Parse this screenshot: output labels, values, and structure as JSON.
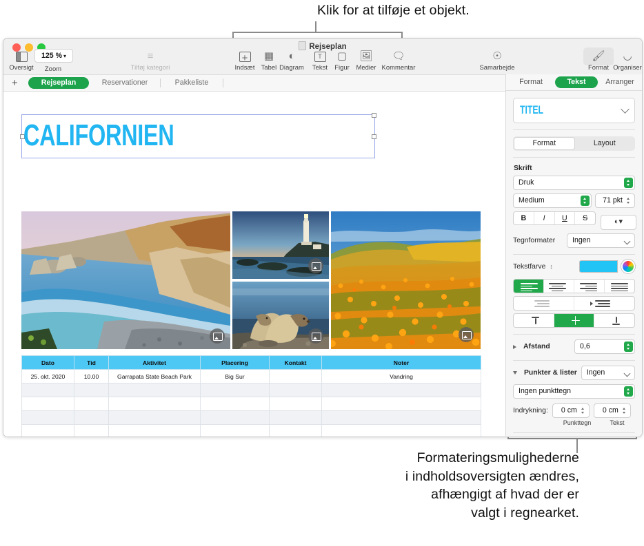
{
  "callouts": {
    "top": "Klik for at tilføje et objekt.",
    "bottom_lines": [
      "Formateringsmulighederne",
      "i indholdsoversigten ændres,",
      "afhængigt af hvad der er",
      "valgt i regnearket."
    ]
  },
  "window": {
    "document_title": "Rejseplan",
    "toolbar": {
      "sidebar_label": "Oversigt",
      "zoom_value": "125 %",
      "zoom_label": "Zoom",
      "add_category_label": "Tilføj kategori",
      "items": [
        {
          "label": "Indsæt",
          "icon": "insert-icon"
        },
        {
          "label": "Tabel",
          "icon": "table-icon"
        },
        {
          "label": "Diagram",
          "icon": "chart-icon"
        },
        {
          "label": "Tekst",
          "icon": "text-icon"
        },
        {
          "label": "Figur",
          "icon": "shape-icon"
        },
        {
          "label": "Medier",
          "icon": "media-icon"
        },
        {
          "label": "Kommentar",
          "icon": "comment-icon"
        }
      ],
      "collaborate_label": "Samarbejde",
      "format_label": "Format",
      "organise_label": "Organiser"
    },
    "sheet_tabs": [
      {
        "label": "Rejseplan",
        "active": true
      },
      {
        "label": "Reservationer",
        "active": false
      },
      {
        "label": "Pakkeliste",
        "active": false
      }
    ]
  },
  "canvas": {
    "big_title": "CALIFORNIEN",
    "section_heading": "Rejseplan",
    "photos": [
      {
        "name": "coastline-photo"
      },
      {
        "name": "lighthouse-photo"
      },
      {
        "name": "sea-lions-photo"
      },
      {
        "name": "poppy-field-photo"
      }
    ],
    "table": {
      "headers": [
        "Dato",
        "Tid",
        "Aktivitet",
        "Placering",
        "Kontakt",
        "Noter"
      ],
      "rows": [
        [
          "25. okt. 2020",
          "10.00",
          "Garrapata State Beach Park",
          "Big Sur",
          "",
          "Vandring"
        ],
        [
          "",
          "",
          "",
          "",
          "",
          ""
        ],
        [
          "",
          "",
          "",
          "",
          "",
          ""
        ],
        [
          "",
          "",
          "",
          "",
          "",
          ""
        ],
        [
          "",
          "",
          "",
          "",
          "",
          ""
        ],
        [
          "",
          "",
          "",
          "",
          "",
          ""
        ]
      ]
    }
  },
  "sidebar": {
    "tabs": [
      {
        "label": "Format",
        "active": false
      },
      {
        "label": "Tekst",
        "active": true
      },
      {
        "label": "Arranger",
        "active": false
      }
    ],
    "paragraph_style": "TITEL",
    "subtabs": [
      {
        "label": "Format",
        "active": true
      },
      {
        "label": "Layout",
        "active": false
      }
    ],
    "font_section_label": "Skrift",
    "font_family": "Druk",
    "font_weight": "Medium",
    "font_size": "71 pkt",
    "style_buttons": [
      "B",
      "I",
      "U",
      "S"
    ],
    "char_styles_label": "Tegnformater",
    "char_styles_value": "Ingen",
    "text_color_label": "Tekstfarve",
    "text_color_hex": "#22c3f5",
    "spacing_label": "Afstand",
    "spacing_value": "0,6",
    "bullets_label": "Punkter & lister",
    "bullets_value": "Ingen",
    "bullet_type": "Ingen punkttegn",
    "indent_label": "Indrykning:",
    "indent_bullet_value": "0 cm",
    "indent_text_value": "0 cm",
    "indent_bullet_label": "Punkttegn",
    "indent_text_label": "Tekst",
    "accent_green": "#1da34c"
  }
}
